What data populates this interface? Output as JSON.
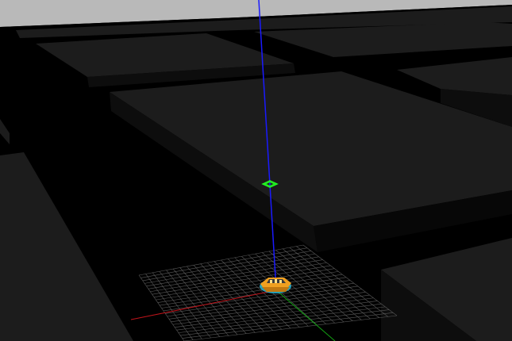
{
  "scene": {
    "sky_color": "#b9b9b9",
    "ground_color": "#000000",
    "block_top_color": "#1c1c1c",
    "block_side_color": "#0d0d0d",
    "block_front_color": "#070707",
    "grid_color": "#5a5a5a",
    "axis_x_color": "#c0141b",
    "axis_y_color": "#12a012",
    "axis_z_color": "#1a1aff",
    "goal_marker_color": "#22ff22",
    "vehicle_body_color": "#f0a020",
    "vehicle_accent_color": "#2ab8d8",
    "vehicle_icon": "car-icon",
    "marker_icon": "target-marker-icon"
  }
}
